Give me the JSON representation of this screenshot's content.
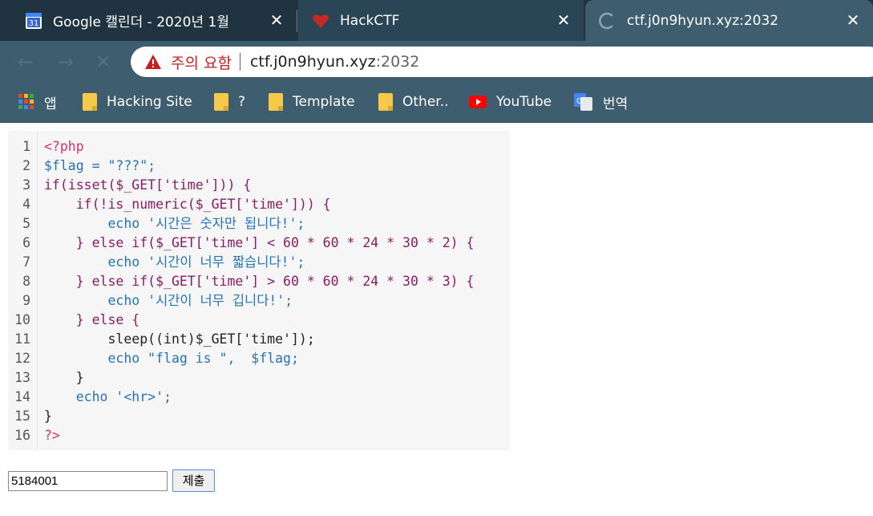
{
  "tabs": [
    {
      "title": "Google 캘린더 - 2020년 1월",
      "favicon": "google-calendar-icon",
      "favicon_text": "31"
    },
    {
      "title": "HackCTF",
      "favicon": "heart-icon"
    },
    {
      "title": "ctf.j0n9hyun.xyz:2032",
      "favicon": "loading-spinner-icon"
    }
  ],
  "omnibox": {
    "warning": "주의 요함",
    "host": "ctf.j0n9hyun.xyz",
    "port": ":2032"
  },
  "bookmarks": [
    {
      "label": "앱",
      "icon": "apps-grid-icon"
    },
    {
      "label": "Hacking Site",
      "icon": "folder-icon"
    },
    {
      "label": "?",
      "icon": "folder-icon"
    },
    {
      "label": "Template",
      "icon": "folder-icon"
    },
    {
      "label": "Other..",
      "icon": "folder-icon"
    },
    {
      "label": "YouTube",
      "icon": "youtube-icon"
    },
    {
      "label": "번역",
      "icon": "google-translate-icon"
    }
  ],
  "code": {
    "line_numbers": [
      "1",
      "2",
      "3",
      "4",
      "5",
      "6",
      "7",
      "8",
      "9",
      "10",
      "11",
      "12",
      "13",
      "14",
      "15",
      "16"
    ],
    "lines": [
      "<?php",
      "$flag = \"???\";",
      "if(isset($_GET['time'])) {",
      "    if(!is_numeric($_GET['time'])) {",
      "        echo '시간은 숫자만 됩니다!';",
      "    } else if($_GET['time'] < 60 * 60 * 24 * 30 * 2) {",
      "        echo '시간이 너무 짧습니다!';",
      "    } else if($_GET['time'] > 60 * 60 * 24 * 30 * 3) {",
      "        echo '시간이 너무 깁니다!';",
      "    } else {",
      "        sleep((int)$_GET['time']);",
      "        echo \"flag is \",  $flag;",
      "    }",
      "    echo '<hr>';",
      "}",
      "?>"
    ]
  },
  "form": {
    "input_value": "5184001",
    "submit_label": "제출"
  }
}
